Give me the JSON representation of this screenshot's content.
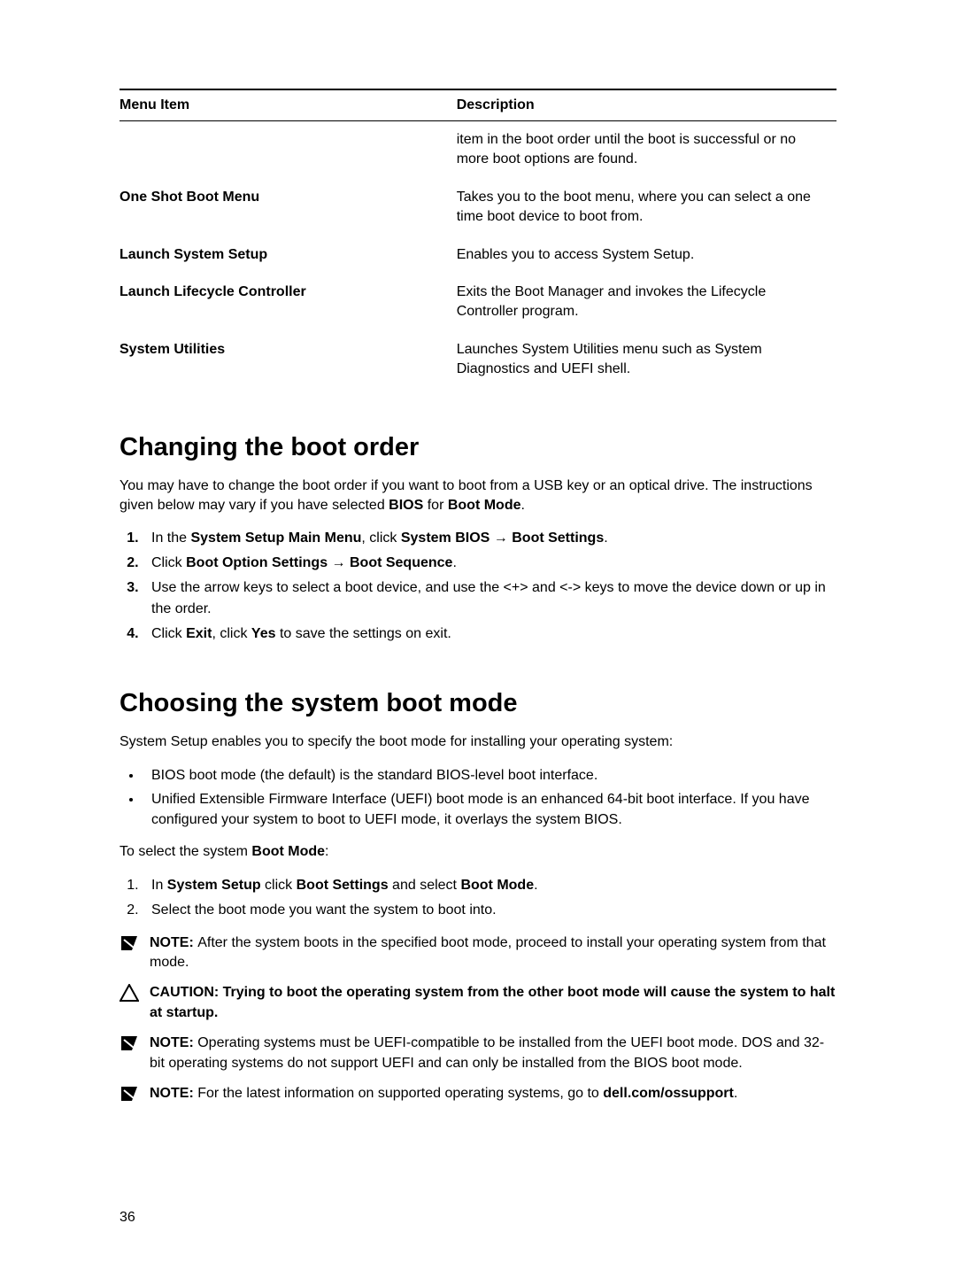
{
  "table": {
    "header_item": "Menu Item",
    "header_desc": "Description",
    "rows": [
      {
        "item": "",
        "desc": "item in the boot order until the boot is successful or no more boot options are found."
      },
      {
        "item": "One Shot Boot Menu",
        "desc": "Takes you to the boot menu, where you can select a one time boot device to boot from."
      },
      {
        "item": "Launch System Setup",
        "desc": "Enables you to access System Setup."
      },
      {
        "item": "Launch Lifecycle Controller",
        "desc": "Exits the Boot Manager and invokes the Lifecycle Controller program."
      },
      {
        "item": "System Utilities",
        "desc": "Launches System Utilities menu such as System Diagnostics and UEFI shell."
      }
    ]
  },
  "section1": {
    "title": "Changing the boot order",
    "intro_a": "You may have to change the boot order if you want to boot from a USB key or an optical drive. The instructions given below may vary if you have selected ",
    "intro_b1": "BIOS",
    "intro_mid": " for ",
    "intro_b2": "Boot Mode",
    "intro_end": ".",
    "step1_a": "In the ",
    "step1_b1": "System Setup Main Menu",
    "step1_mid": ", click ",
    "step1_b2": "System BIOS",
    "step1_arrow": " → ",
    "step1_b3": "Boot Settings",
    "step1_end": ".",
    "step2_a": "Click ",
    "step2_b1": "Boot Option Settings",
    "step2_arrow": " → ",
    "step2_b2": "Boot Sequence",
    "step2_end": ".",
    "step3": "Use the arrow keys to select a boot device, and use the <+> and <-> keys to move the device down or up in the order.",
    "step4_a": "Click ",
    "step4_b1": "Exit",
    "step4_mid": ", click ",
    "step4_b2": "Yes",
    "step4_end": " to save the settings on exit."
  },
  "section2": {
    "title": "Choosing the system boot mode",
    "intro": "System Setup enables you to specify the boot mode for installing your operating system:",
    "bullet1": "BIOS boot mode (the default) is the standard BIOS-level boot interface.",
    "bullet2": "Unified Extensible Firmware Interface (UEFI) boot mode is an enhanced 64-bit boot interface. If you have configured your system to boot to UEFI mode, it overlays the system BIOS.",
    "select_a": "To select the system ",
    "select_b": "Boot Mode",
    "select_end": ":",
    "step1_a": "In ",
    "step1_b1": "System Setup",
    "step1_mid1": " click ",
    "step1_b2": "Boot Settings",
    "step1_mid2": " and select ",
    "step1_b3": "Boot Mode",
    "step1_end": ".",
    "step2": "Select the boot mode you want the system to boot into.",
    "note1_label": "NOTE: ",
    "note1_text": "After the system boots in the specified boot mode, proceed to install your operating system from that mode.",
    "caution_label": "CAUTION: ",
    "caution_text": "Trying to boot the operating system from the other boot mode will cause the system to halt at startup.",
    "note2_label": "NOTE: ",
    "note2_text": "Operating systems must be UEFI-compatible to be installed from the UEFI boot mode. DOS and 32-bit operating systems do not support UEFI and can only be installed from the BIOS boot mode.",
    "note3_label": "NOTE: ",
    "note3_text_a": "For the latest information on supported operating systems, go to ",
    "note3_link": "dell.com/ossupport",
    "note3_end": "."
  },
  "page_number": "36"
}
